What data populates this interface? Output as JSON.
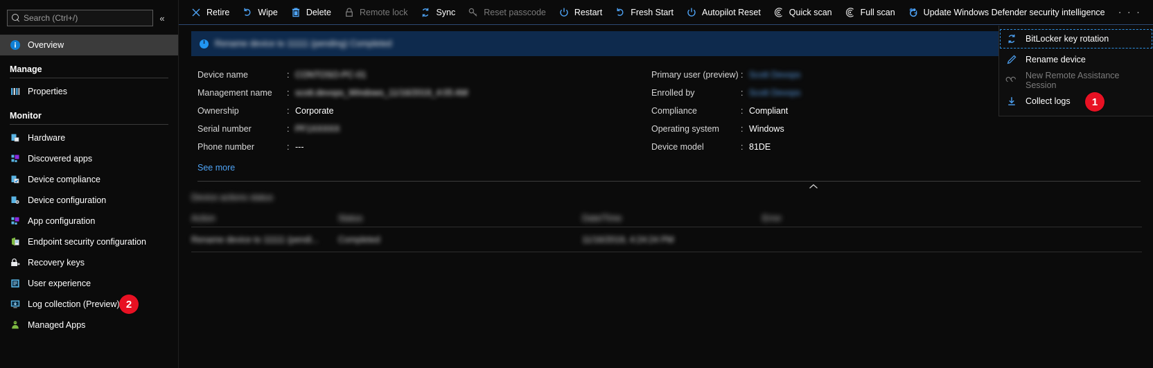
{
  "sidebar": {
    "search": {
      "placeholder": "Search (Ctrl+/)",
      "value": "",
      "icon": "search-icon"
    },
    "collapse_label": "«",
    "overview": {
      "label": "Overview",
      "icon": "info-icon",
      "active": true
    },
    "sections": [
      {
        "title": "Manage",
        "items": [
          {
            "label": "Properties",
            "icon": "properties-icon"
          }
        ]
      },
      {
        "title": "Monitor",
        "items": [
          {
            "label": "Hardware",
            "icon": "hardware-icon"
          },
          {
            "label": "Discovered apps",
            "icon": "discovered-apps-icon"
          },
          {
            "label": "Device compliance",
            "icon": "device-compliance-icon"
          },
          {
            "label": "Device configuration",
            "icon": "device-configuration-icon"
          },
          {
            "label": "App configuration",
            "icon": "app-configuration-icon"
          },
          {
            "label": "Endpoint security configuration",
            "icon": "endpoint-security-icon"
          },
          {
            "label": "Recovery keys",
            "icon": "lock-key-icon"
          },
          {
            "label": "User experience",
            "icon": "user-experience-icon"
          },
          {
            "label": "Log collection (Preview)",
            "icon": "log-collection-icon"
          },
          {
            "label": "Managed Apps",
            "icon": "managed-apps-icon"
          }
        ]
      }
    ]
  },
  "toolbar": {
    "items": [
      {
        "label": "Retire",
        "icon": "x-icon",
        "disabled": false
      },
      {
        "label": "Wipe",
        "icon": "undo-icon",
        "disabled": false
      },
      {
        "label": "Delete",
        "icon": "trash-icon",
        "disabled": false
      },
      {
        "label": "Remote lock",
        "icon": "lock-icon",
        "disabled": true
      },
      {
        "label": "Sync",
        "icon": "sync-icon",
        "disabled": false
      },
      {
        "label": "Reset passcode",
        "icon": "key-icon",
        "disabled": true
      },
      {
        "label": "Restart",
        "icon": "power-icon",
        "disabled": false
      },
      {
        "label": "Fresh Start",
        "icon": "undo-icon",
        "disabled": false
      },
      {
        "label": "Autopilot Reset",
        "icon": "power-icon",
        "disabled": false
      },
      {
        "label": "Quick scan",
        "icon": "scan-icon",
        "disabled": false
      },
      {
        "label": "Full scan",
        "icon": "scan-icon",
        "disabled": false
      },
      {
        "label": "Update Windows Defender security intelligence",
        "icon": "defender-icon",
        "disabled": false
      }
    ],
    "overflow_label": "· · ·"
  },
  "menu": {
    "items": [
      {
        "label": "BitLocker key rotation",
        "icon": "rotate-icon",
        "disabled": false,
        "focused": true
      },
      {
        "label": "Rename device",
        "icon": "pencil-icon",
        "disabled": false,
        "focused": false
      },
      {
        "label": "New Remote Assistance Session",
        "icon": "remote-assist-icon",
        "disabled": true,
        "focused": false
      },
      {
        "label": "Collect logs",
        "icon": "download-icon",
        "disabled": false,
        "focused": false
      }
    ]
  },
  "badges": [
    {
      "number": "1",
      "target": "collect-logs"
    },
    {
      "number": "2",
      "target": "log-collection-sidebar"
    }
  ],
  "banner": {
    "icon": "info-circle-icon",
    "text": "Rename device to 11111 (pending) Completed",
    "redacted": true
  },
  "details": {
    "left": [
      {
        "label": "Device name",
        "value": "CONTOSO-PC-01",
        "redacted": true
      },
      {
        "label": "Management name",
        "value": "scott.devops_Windows_11/16/2019_4:05 AM",
        "redacted": true
      },
      {
        "label": "Ownership",
        "value": "Corporate",
        "redacted": false
      },
      {
        "label": "Serial number",
        "value": "PF1XXXXX",
        "redacted": true
      },
      {
        "label": "Phone number",
        "value": "---",
        "redacted": false
      }
    ],
    "right": [
      {
        "label": "Primary user (preview)",
        "value": "Scott Devops",
        "redacted": true,
        "link": true
      },
      {
        "label": "Enrolled by",
        "value": "Scott Devops",
        "redacted": true,
        "link": true
      },
      {
        "label": "Compliance",
        "value": "Compliant",
        "redacted": false
      },
      {
        "label": "Operating system",
        "value": "Windows",
        "redacted": false
      },
      {
        "label": "Device model",
        "value": "81DE",
        "redacted": false
      }
    ],
    "see_more_label": "See more",
    "collapse_icon": "chevron-up-icon"
  },
  "device_actions": {
    "title": "Device actions status",
    "title_redacted": true,
    "columns": [
      "Action",
      "Status",
      "Date/Time",
      "Error"
    ],
    "rows": [
      {
        "cells": [
          "Rename device to 11111 (pendi...",
          "Completed",
          "11/16/2019, 4:24:24 PM",
          ""
        ],
        "redacted": true
      }
    ]
  }
}
